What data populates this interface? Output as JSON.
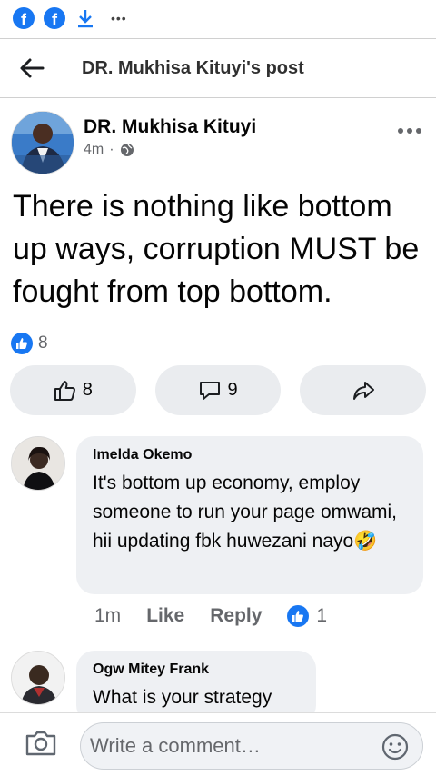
{
  "statusbar": {
    "overflow_dots": "•••"
  },
  "header": {
    "title": "DR. Mukhisa Kituyi's post"
  },
  "post": {
    "author": "DR. Mukhisa Kituyi",
    "time": "4m",
    "separator": "·",
    "text": "There is nothing like bottom up ways, corruption MUST be fought from top bottom.",
    "reaction_count": "8"
  },
  "actions": {
    "like_count": "8",
    "comment_count": "9"
  },
  "comments": [
    {
      "name": "Imelda Okemo",
      "text": "It's bottom up economy, employ someone to run your page omwami, hii updating fbk huwezani nayo🤣",
      "time": "1m",
      "like_label": "Like",
      "reply_label": "Reply",
      "reaction_count": "1"
    },
    {
      "name": "Ogw Mitey Frank",
      "text": "What is your strategy"
    }
  ],
  "composer": {
    "placeholder": "Write a comment…"
  },
  "colors": {
    "accent": "#1877f2",
    "secondary_text": "#65676b",
    "bubble": "#eef0f3"
  }
}
